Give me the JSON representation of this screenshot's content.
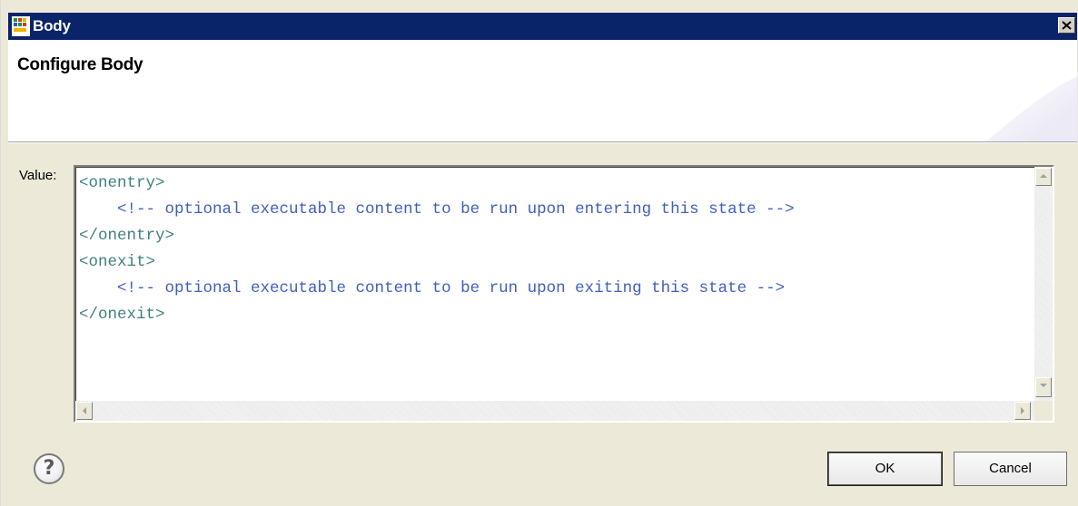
{
  "window": {
    "title": "Body",
    "close_icon": "close-icon",
    "app_icon": "scxml-body-icon"
  },
  "banner": {
    "title": "Configure Body"
  },
  "form": {
    "value_label": "Value:",
    "lines": [
      {
        "indent": "",
        "text": "<onentry>",
        "kind": "tag"
      },
      {
        "indent": "    ",
        "text": "<!-- optional executable content to be run upon entering this state -->",
        "kind": "comment"
      },
      {
        "indent": "",
        "text": "</onentry>",
        "kind": "tag"
      },
      {
        "indent": "",
        "text": "<onexit>",
        "kind": "tag"
      },
      {
        "indent": "    ",
        "text": "<!-- optional executable content to be run upon exiting this state -->",
        "kind": "comment"
      },
      {
        "indent": "",
        "text": "</onexit>",
        "kind": "tag"
      }
    ]
  },
  "buttons": {
    "help_symbol": "?",
    "ok_label": "OK",
    "cancel_label": "Cancel"
  },
  "colors": {
    "titlebar": "#0a246a",
    "tag": "#3f7f7f",
    "comment": "#3f5fbf",
    "dialog_bg": "#ece9d8"
  }
}
